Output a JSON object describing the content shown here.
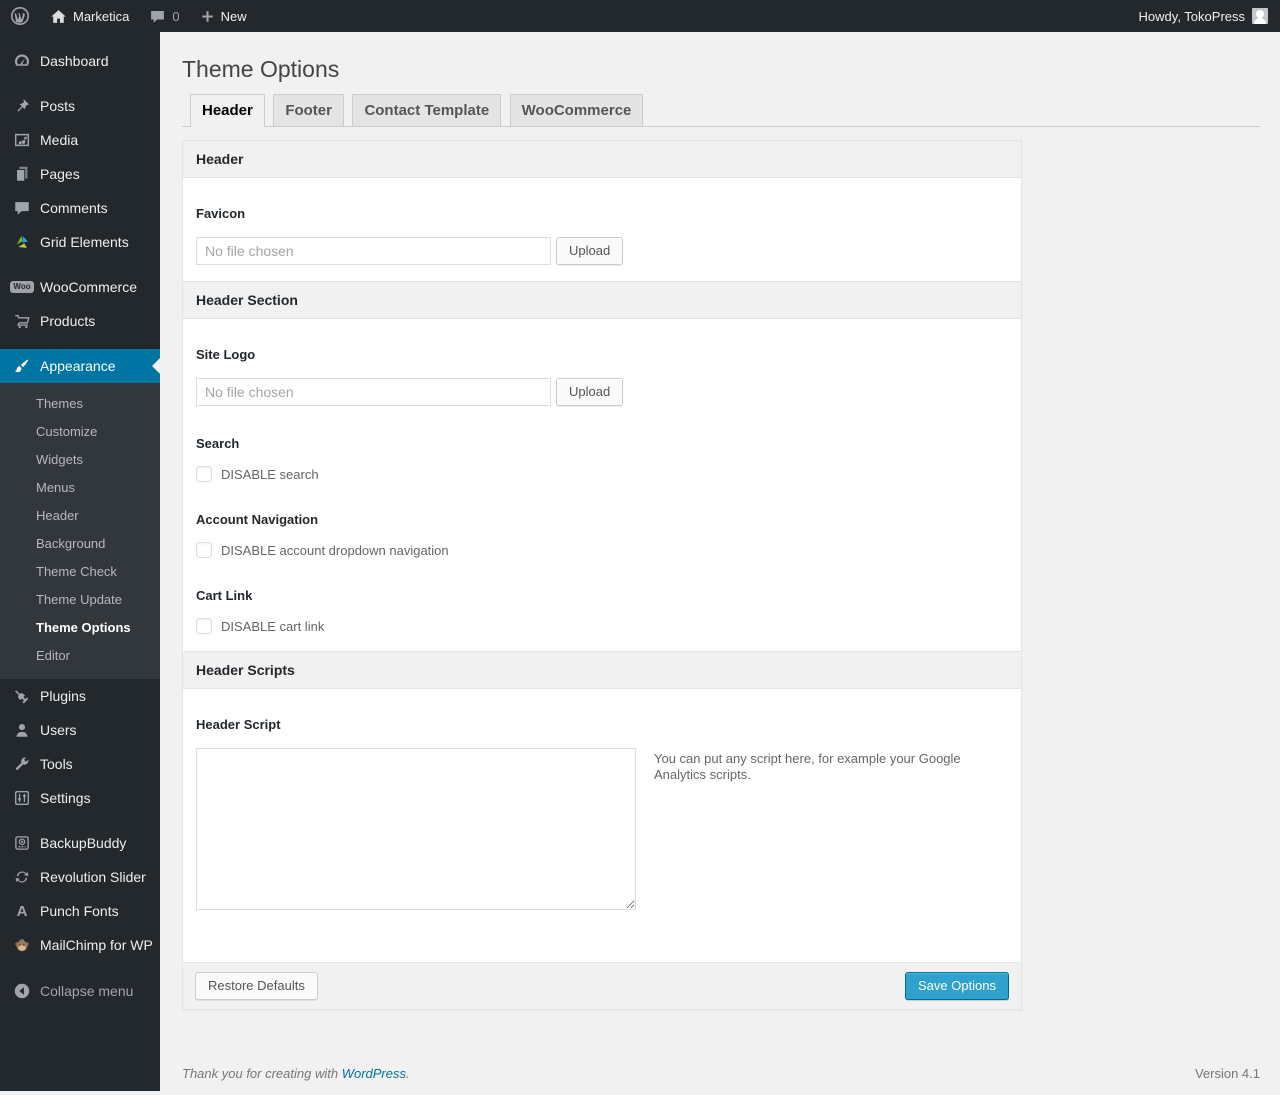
{
  "colors": {
    "accent": "#0074a2",
    "primary_button": "#2ea2cc",
    "sidebar_bg": "#23282d",
    "page_bg": "#f1f1f1",
    "link": "#0074a2"
  },
  "admin_bar": {
    "site_name": "Marketica",
    "comment_count": "0",
    "new_label": "New",
    "howdy": "Howdy, TokoPress"
  },
  "icon_glyphs": {
    "wordpress_w": "W",
    "woo": "Woo",
    "punch_fonts": "A"
  },
  "sidebar": {
    "items": [
      {
        "label": "Dashboard",
        "icon": "dashboard-icon"
      },
      {
        "label": "Posts",
        "icon": "pin-icon"
      },
      {
        "label": "Media",
        "icon": "media-icon"
      },
      {
        "label": "Pages",
        "icon": "pages-icon"
      },
      {
        "label": "Comments",
        "icon": "comment-icon"
      },
      {
        "label": "Grid Elements",
        "icon": "grid-elements-icon"
      },
      {
        "label": "WooCommerce",
        "icon": "woocommerce-badge-icon"
      },
      {
        "label": "Products",
        "icon": "cart-icon"
      },
      {
        "label": "Appearance",
        "icon": "brush-icon",
        "active": true
      },
      {
        "label": "Plugins",
        "icon": "plug-icon"
      },
      {
        "label": "Users",
        "icon": "user-icon"
      },
      {
        "label": "Tools",
        "icon": "wrench-icon"
      },
      {
        "label": "Settings",
        "icon": "sliders-icon"
      },
      {
        "label": "BackupBuddy",
        "icon": "backup-icon"
      },
      {
        "label": "Revolution Slider",
        "icon": "refresh-icon"
      },
      {
        "label": "Punch Fonts",
        "icon": "letter-a-icon"
      },
      {
        "label": "MailChimp for WP",
        "icon": "mailchimp-icon"
      }
    ],
    "submenu": {
      "items": [
        {
          "label": "Themes"
        },
        {
          "label": "Customize"
        },
        {
          "label": "Widgets"
        },
        {
          "label": "Menus"
        },
        {
          "label": "Header"
        },
        {
          "label": "Background"
        },
        {
          "label": "Theme Check"
        },
        {
          "label": "Theme Update"
        },
        {
          "label": "Theme Options",
          "current": true
        },
        {
          "label": "Editor"
        }
      ]
    },
    "collapse_label": "Collapse menu"
  },
  "page": {
    "title": "Theme Options",
    "tabs": [
      {
        "label": "Header",
        "active": true
      },
      {
        "label": "Footer"
      },
      {
        "label": "Contact Template"
      },
      {
        "label": "WooCommerce"
      }
    ]
  },
  "panel": {
    "section_header": {
      "title": "Header"
    },
    "favicon": {
      "label": "Favicon",
      "placeholder": "No file chosen",
      "button": "Upload"
    },
    "section_header_section": {
      "title": "Header Section"
    },
    "site_logo": {
      "label": "Site Logo",
      "placeholder": "No file chosen",
      "button": "Upload"
    },
    "search": {
      "label": "Search",
      "checkbox_label": "DISABLE search",
      "checked": false
    },
    "account_nav": {
      "label": "Account Navigation",
      "checkbox_label": "DISABLE account dropdown navigation",
      "checked": false
    },
    "cart_link": {
      "label": "Cart Link",
      "checkbox_label": "DISABLE cart link",
      "checked": false
    },
    "section_scripts": {
      "title": "Header Scripts"
    },
    "header_script": {
      "label": "Header Script",
      "value": "",
      "help": "You can put any script here, for example your Google Analytics scripts."
    },
    "actions": {
      "restore": "Restore Defaults",
      "save": "Save Options"
    }
  },
  "footer": {
    "thanks_prefix": "Thank you for creating with ",
    "link_text": "WordPress",
    "suffix": ".",
    "version": "Version 4.1"
  }
}
